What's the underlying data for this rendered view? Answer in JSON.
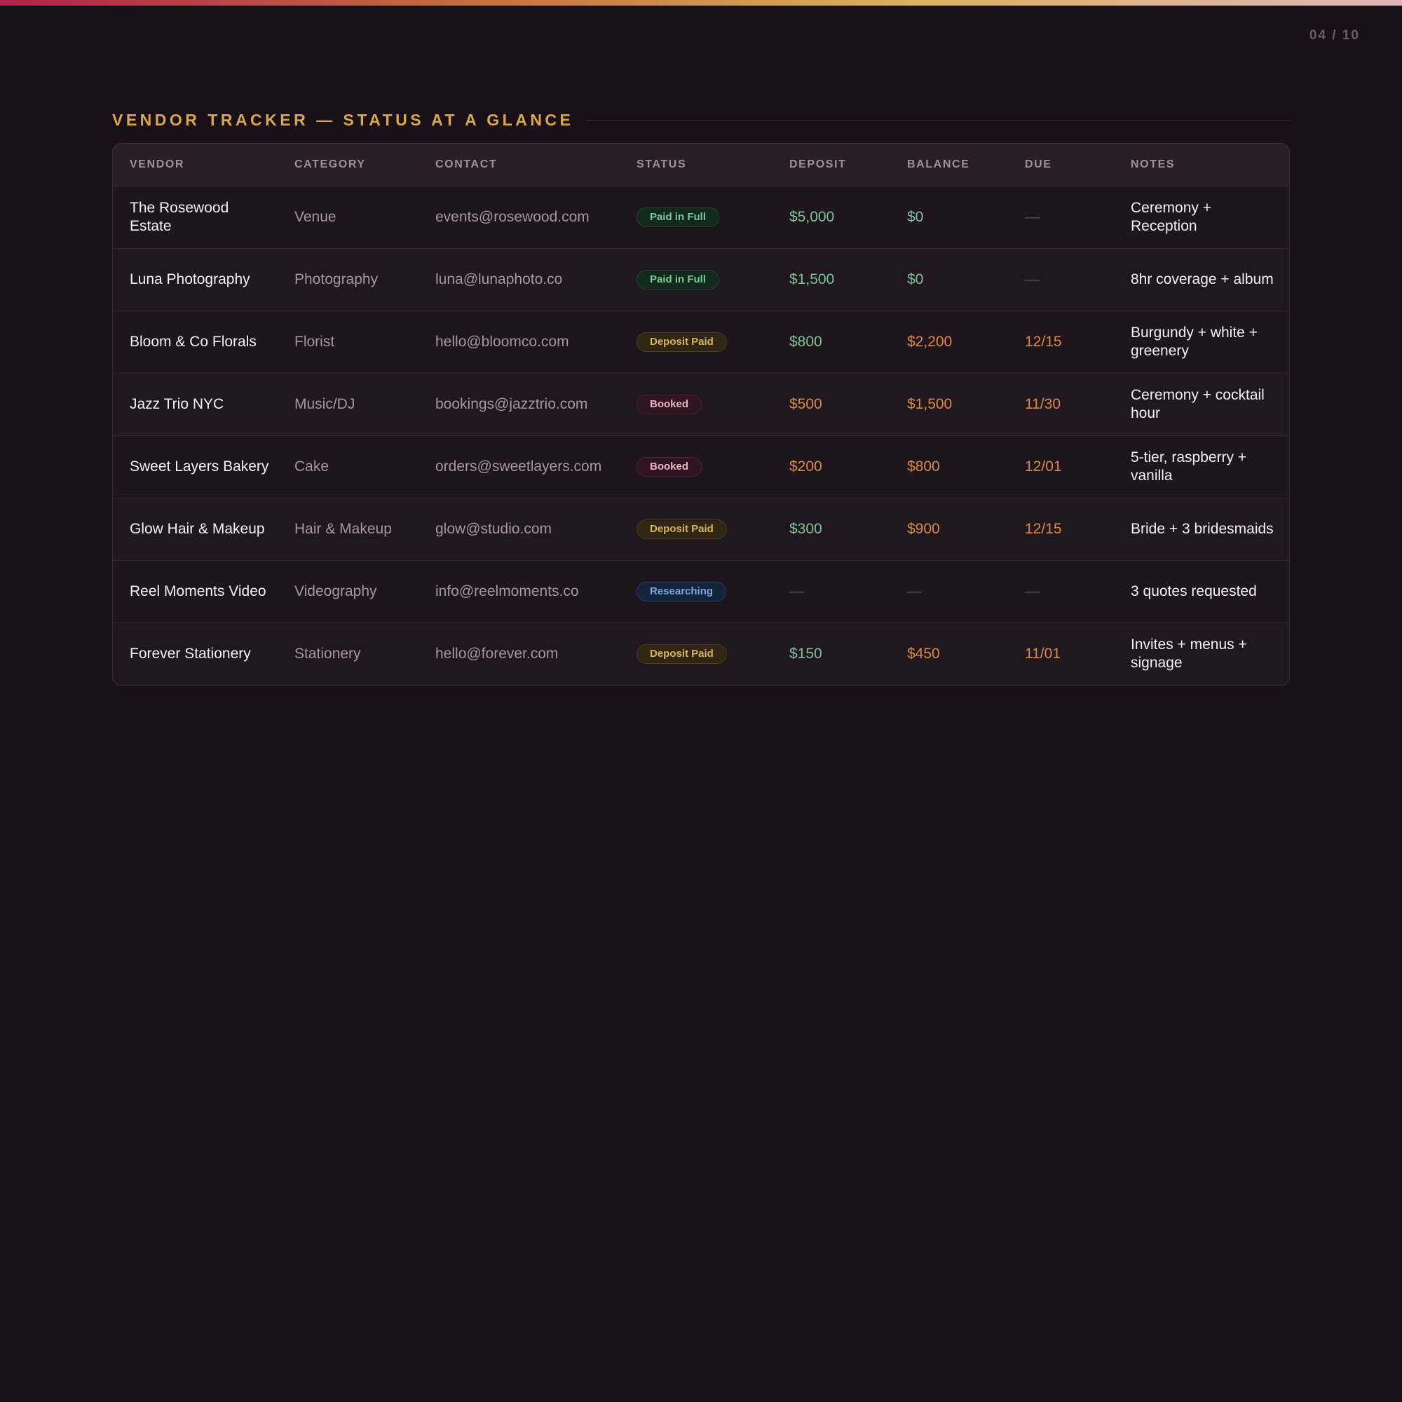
{
  "page": {
    "counter": "04 / 10",
    "title": "VENDOR TRACKER — STATUS AT A GLANCE"
  },
  "colors": {
    "accent_gold": "#d6a94f",
    "green": "#7fc29a",
    "orange": "#d98a48",
    "background": "#1a1018"
  },
  "table": {
    "headers": [
      "VENDOR",
      "CATEGORY",
      "CONTACT",
      "STATUS",
      "DEPOSIT",
      "BALANCE",
      "DUE",
      "NOTES"
    ],
    "rows": [
      {
        "vendor": "The Rosewood Estate",
        "category": "Venue",
        "contact": "events@rosewood.com",
        "status": "Paid in Full",
        "status_kind": "paid",
        "deposit": "$5,000",
        "deposit_tone": "green",
        "balance": "$0",
        "balance_tone": "green",
        "due": "—",
        "due_tone": "dash",
        "notes": "Ceremony + Reception"
      },
      {
        "vendor": "Luna Photography",
        "category": "Photography",
        "contact": "luna@lunaphoto.co",
        "status": "Paid in Full",
        "status_kind": "paid",
        "deposit": "$1,500",
        "deposit_tone": "green",
        "balance": "$0",
        "balance_tone": "green",
        "due": "—",
        "due_tone": "dash",
        "notes": "8hr coverage + album"
      },
      {
        "vendor": "Bloom & Co Florals",
        "category": "Florist",
        "contact": "hello@bloomco.com",
        "status": "Deposit Paid",
        "status_kind": "deposit",
        "deposit": "$800",
        "deposit_tone": "green",
        "balance": "$2,200",
        "balance_tone": "orange",
        "due": "12/15",
        "due_tone": "orange",
        "notes": "Burgundy + white + greenery"
      },
      {
        "vendor": "Jazz Trio NYC",
        "category": "Music/DJ",
        "contact": "bookings@jazztrio.com",
        "status": "Booked",
        "status_kind": "booked",
        "deposit": "$500",
        "deposit_tone": "orange",
        "balance": "$1,500",
        "balance_tone": "orange",
        "due": "11/30",
        "due_tone": "orange",
        "notes": "Ceremony + cocktail hour"
      },
      {
        "vendor": "Sweet Layers Bakery",
        "category": "Cake",
        "contact": "orders@sweetlayers.com",
        "status": "Booked",
        "status_kind": "booked",
        "deposit": "$200",
        "deposit_tone": "orange",
        "balance": "$800",
        "balance_tone": "orange",
        "due": "12/01",
        "due_tone": "orange",
        "notes": "5-tier, raspberry + vanilla"
      },
      {
        "vendor": "Glow Hair & Makeup",
        "category": "Hair & Makeup",
        "contact": "glow@studio.com",
        "status": "Deposit Paid",
        "status_kind": "deposit",
        "deposit": "$300",
        "deposit_tone": "green",
        "balance": "$900",
        "balance_tone": "orange",
        "due": "12/15",
        "due_tone": "orange",
        "notes": "Bride + 3 bridesmaids"
      },
      {
        "vendor": "Reel Moments Video",
        "category": "Videography",
        "contact": "info@reelmoments.co",
        "status": "Researching",
        "status_kind": "research",
        "deposit": "—",
        "deposit_tone": "dash",
        "balance": "—",
        "balance_tone": "dash",
        "due": "—",
        "due_tone": "dash",
        "notes": "3 quotes requested"
      },
      {
        "vendor": "Forever Stationery",
        "category": "Stationery",
        "contact": "hello@forever.com",
        "status": "Deposit Paid",
        "status_kind": "deposit",
        "deposit": "$150",
        "deposit_tone": "green",
        "balance": "$450",
        "balance_tone": "orange",
        "due": "11/01",
        "due_tone": "orange",
        "notes": "Invites + menus + signage"
      }
    ]
  }
}
